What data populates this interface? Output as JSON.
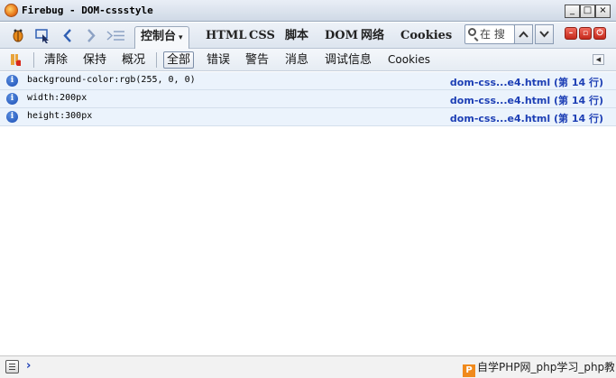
{
  "window": {
    "title": "Firebug - DOM-cssstyle",
    "minimize": "_",
    "maximize": "□",
    "close": "×"
  },
  "toolbar": {
    "tabs": [
      {
        "label": "控制台",
        "active": true
      },
      {
        "label": "HTML"
      },
      {
        "label": "CSS"
      },
      {
        "label": "脚本"
      },
      {
        "label": "DOM"
      },
      {
        "label": "网络"
      },
      {
        "label": "Cookies"
      }
    ],
    "active_tab_arrow": "▾",
    "search_placeholder": "在 搜",
    "icons": [
      "firebug-icon",
      "inspect-icon",
      "back-icon",
      "forward-icon",
      "command-editor-icon"
    ]
  },
  "console_toolbar": {
    "buttons": [
      "清除",
      "保持",
      "概况"
    ],
    "filters": [
      {
        "label": "全部",
        "active": true
      },
      {
        "label": "错误"
      },
      {
        "label": "警告"
      },
      {
        "label": "消息"
      },
      {
        "label": "调试信息"
      },
      {
        "label": "Cookies"
      }
    ]
  },
  "log": {
    "rows": [
      {
        "message": "background-color:rgb(255, 0, 0)",
        "source": "dom-css...e4.html (第 14 行)"
      },
      {
        "message": "width:200px",
        "source": "dom-css...e4.html (第 14 行)"
      },
      {
        "message": "height:300px",
        "source": "dom-css...e4.html (第 14 行)"
      }
    ]
  },
  "bottom": {
    "prompt": "›",
    "watermark": "自学PHP网_php学习_php教程",
    "watermark_logo": "P"
  },
  "colors": {
    "link": "#1d3fb5",
    "row_background": "#ebf3fc"
  }
}
